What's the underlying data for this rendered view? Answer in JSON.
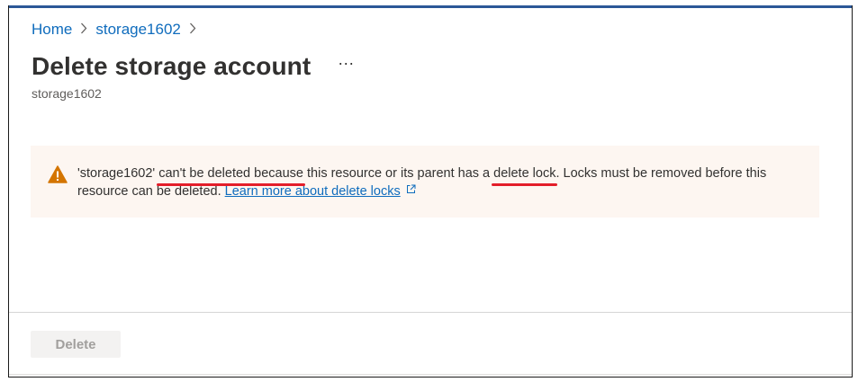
{
  "breadcrumb": {
    "items": [
      {
        "label": "Home"
      },
      {
        "label": "storage1602"
      }
    ],
    "separator": ">"
  },
  "header": {
    "title": "Delete storage account",
    "more_label": "···",
    "subtitle": "storage1602"
  },
  "banner": {
    "icon": "warning-icon",
    "text_part1": "'storage1602' ",
    "highlight1": "can't be deleted because",
    "text_part2": " this resource or its parent has a ",
    "highlight2": "delete lock",
    "text_part3": ". Locks must be removed before this resource can be deleted.",
    "link_label": "Learn more about delete locks",
    "link_icon": "external-link-icon",
    "background": "#fdf6f1",
    "icon_color": "#d47500",
    "highlight_color": "#e31e2a"
  },
  "footer": {
    "delete_label": "Delete",
    "delete_disabled": true
  },
  "colors": {
    "accent": "#0f6cbd",
    "top_bar": "#2b5797"
  }
}
